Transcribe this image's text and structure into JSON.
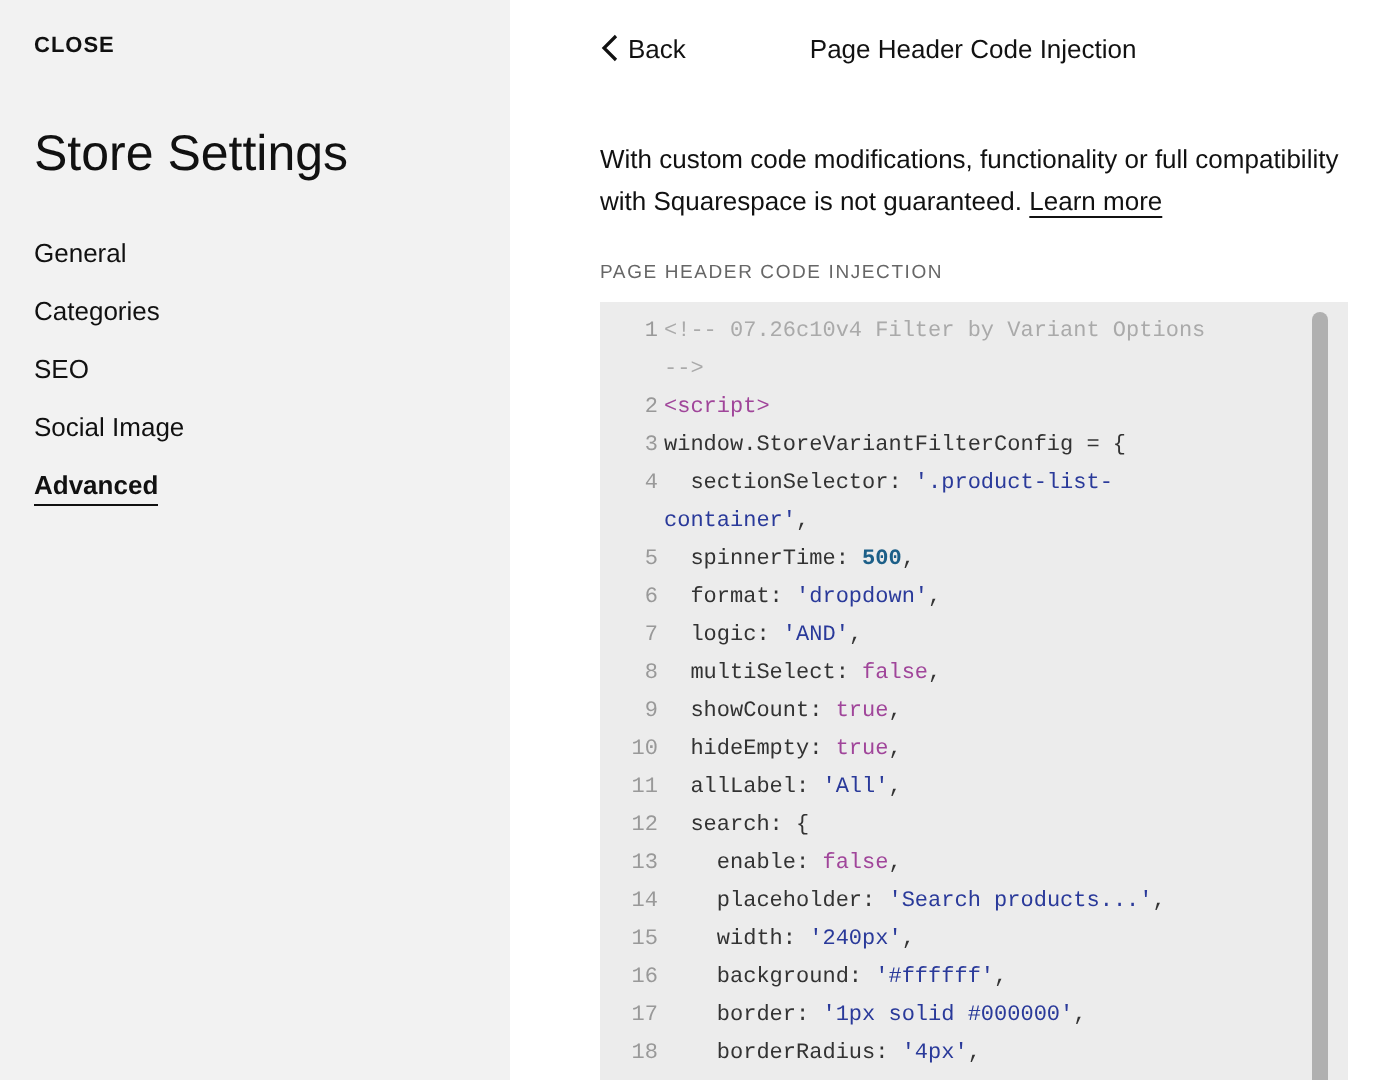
{
  "sidebar": {
    "close": "CLOSE",
    "title": "Store Settings",
    "items": [
      {
        "label": "General",
        "selected": false
      },
      {
        "label": "Categories",
        "selected": false
      },
      {
        "label": "SEO",
        "selected": false
      },
      {
        "label": "Social Image",
        "selected": false
      },
      {
        "label": "Advanced",
        "selected": true
      }
    ]
  },
  "header": {
    "back": "Back",
    "title": "Page Header Code Injection"
  },
  "notice": {
    "text": "With custom code modifications, functionality or full compatibility with Squarespace is not guaranteed.",
    "link": "Learn more"
  },
  "editor": {
    "label": "PAGE HEADER CODE INJECTION",
    "lines": [
      {
        "number": "1",
        "tokens": [
          {
            "kind": "comment",
            "text": "<!-- 07.26c10v4 Filter by Variant Options -->"
          }
        ]
      },
      {
        "number": "2",
        "tokens": [
          {
            "kind": "tag",
            "text": "<script>"
          }
        ]
      },
      {
        "number": "3",
        "tokens": [
          {
            "kind": "plain",
            "text": "window.StoreVariantFilterConfig = {"
          }
        ]
      },
      {
        "number": "4",
        "tokens": [
          {
            "kind": "plain",
            "text": "  sectionSelector: "
          },
          {
            "kind": "string",
            "text": "'.product-list-container'"
          },
          {
            "kind": "plain",
            "text": ","
          }
        ]
      },
      {
        "number": "5",
        "tokens": [
          {
            "kind": "plain",
            "text": "  spinnerTime: "
          },
          {
            "kind": "number",
            "text": "500"
          },
          {
            "kind": "plain",
            "text": ","
          }
        ]
      },
      {
        "number": "6",
        "tokens": [
          {
            "kind": "plain",
            "text": "  format: "
          },
          {
            "kind": "string",
            "text": "'dropdown'"
          },
          {
            "kind": "plain",
            "text": ","
          }
        ]
      },
      {
        "number": "7",
        "tokens": [
          {
            "kind": "plain",
            "text": "  logic: "
          },
          {
            "kind": "string",
            "text": "'AND'"
          },
          {
            "kind": "plain",
            "text": ","
          }
        ]
      },
      {
        "number": "8",
        "tokens": [
          {
            "kind": "plain",
            "text": "  multiSelect: "
          },
          {
            "kind": "keyword",
            "text": "false"
          },
          {
            "kind": "plain",
            "text": ","
          }
        ]
      },
      {
        "number": "9",
        "tokens": [
          {
            "kind": "plain",
            "text": "  showCount: "
          },
          {
            "kind": "keyword",
            "text": "true"
          },
          {
            "kind": "plain",
            "text": ","
          }
        ]
      },
      {
        "number": "10",
        "tokens": [
          {
            "kind": "plain",
            "text": "  hideEmpty: "
          },
          {
            "kind": "keyword",
            "text": "true"
          },
          {
            "kind": "plain",
            "text": ","
          }
        ]
      },
      {
        "number": "11",
        "tokens": [
          {
            "kind": "plain",
            "text": "  allLabel: "
          },
          {
            "kind": "string",
            "text": "'All'"
          },
          {
            "kind": "plain",
            "text": ","
          }
        ]
      },
      {
        "number": "12",
        "tokens": [
          {
            "kind": "plain",
            "text": "  search: {"
          }
        ]
      },
      {
        "number": "13",
        "tokens": [
          {
            "kind": "plain",
            "text": "    enable: "
          },
          {
            "kind": "keyword",
            "text": "false"
          },
          {
            "kind": "plain",
            "text": ","
          }
        ]
      },
      {
        "number": "14",
        "tokens": [
          {
            "kind": "plain",
            "text": "    placeholder: "
          },
          {
            "kind": "string",
            "text": "'Search products...'"
          },
          {
            "kind": "plain",
            "text": ","
          }
        ]
      },
      {
        "number": "15",
        "tokens": [
          {
            "kind": "plain",
            "text": "    width: "
          },
          {
            "kind": "string",
            "text": "'240px'"
          },
          {
            "kind": "plain",
            "text": ","
          }
        ]
      },
      {
        "number": "16",
        "tokens": [
          {
            "kind": "plain",
            "text": "    background: "
          },
          {
            "kind": "string",
            "text": "'#ffffff'"
          },
          {
            "kind": "plain",
            "text": ","
          }
        ]
      },
      {
        "number": "17",
        "tokens": [
          {
            "kind": "plain",
            "text": "    border: "
          },
          {
            "kind": "string",
            "text": "'1px solid #000000'"
          },
          {
            "kind": "plain",
            "text": ","
          }
        ]
      },
      {
        "number": "18",
        "tokens": [
          {
            "kind": "plain",
            "text": "    borderRadius: "
          },
          {
            "kind": "string",
            "text": "'4px'"
          },
          {
            "kind": "plain",
            "text": ","
          }
        ]
      }
    ]
  }
}
